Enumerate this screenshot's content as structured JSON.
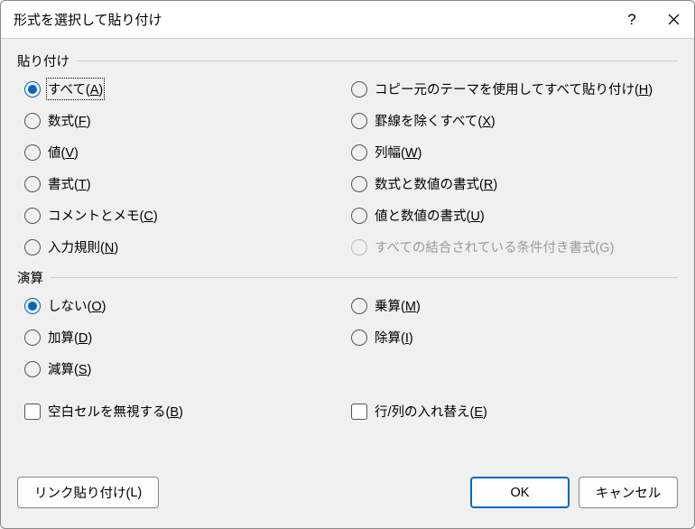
{
  "title": "形式を選択して貼り付け",
  "help_symbol": "?",
  "groups": {
    "paste": {
      "label": "貼り付け",
      "left": [
        {
          "text": "すべて(",
          "key": "A",
          "tail": ")",
          "selected": true,
          "focused": true
        },
        {
          "text": "数式(",
          "key": "F",
          "tail": ")"
        },
        {
          "text": "値(",
          "key": "V",
          "tail": ")"
        },
        {
          "text": "書式(",
          "key": "T",
          "tail": ")"
        },
        {
          "text": "コメントとメモ(",
          "key": "C",
          "tail": ")"
        },
        {
          "text": "入力規則(",
          "key": "N",
          "tail": ")"
        }
      ],
      "right": [
        {
          "text": "コピー元のテーマを使用してすべて貼り付け(",
          "key": "H",
          "tail": ")"
        },
        {
          "text": "罫線を除くすべて(",
          "key": "X",
          "tail": ")"
        },
        {
          "text": "列幅(",
          "key": "W",
          "tail": ")"
        },
        {
          "text": "数式と数値の書式(",
          "key": "R",
          "tail": ")"
        },
        {
          "text": "値と数値の書式(",
          "key": "U",
          "tail": ")"
        },
        {
          "text": "すべての結合されている条件付き書式(G)",
          "key": "",
          "tail": "",
          "disabled": true
        }
      ]
    },
    "operation": {
      "label": "演算",
      "left": [
        {
          "text": "しない(",
          "key": "O",
          "tail": ")",
          "selected": true
        },
        {
          "text": "加算(",
          "key": "D",
          "tail": ")"
        },
        {
          "text": "減算(",
          "key": "S",
          "tail": ")"
        }
      ],
      "right": [
        {
          "text": "乗算(",
          "key": "M",
          "tail": ")"
        },
        {
          "text": "除算(",
          "key": "I",
          "tail": ")"
        }
      ]
    }
  },
  "checks": {
    "skip_blanks": {
      "text": "空白セルを無視する(",
      "key": "B",
      "tail": ")"
    },
    "transpose": {
      "text": "行/列の入れ替え(",
      "key": "E",
      "tail": ")"
    }
  },
  "buttons": {
    "paste_link": {
      "text": "リンク貼り付け(",
      "key": "L",
      "tail": ")"
    },
    "ok": "OK",
    "cancel": "キャンセル"
  }
}
